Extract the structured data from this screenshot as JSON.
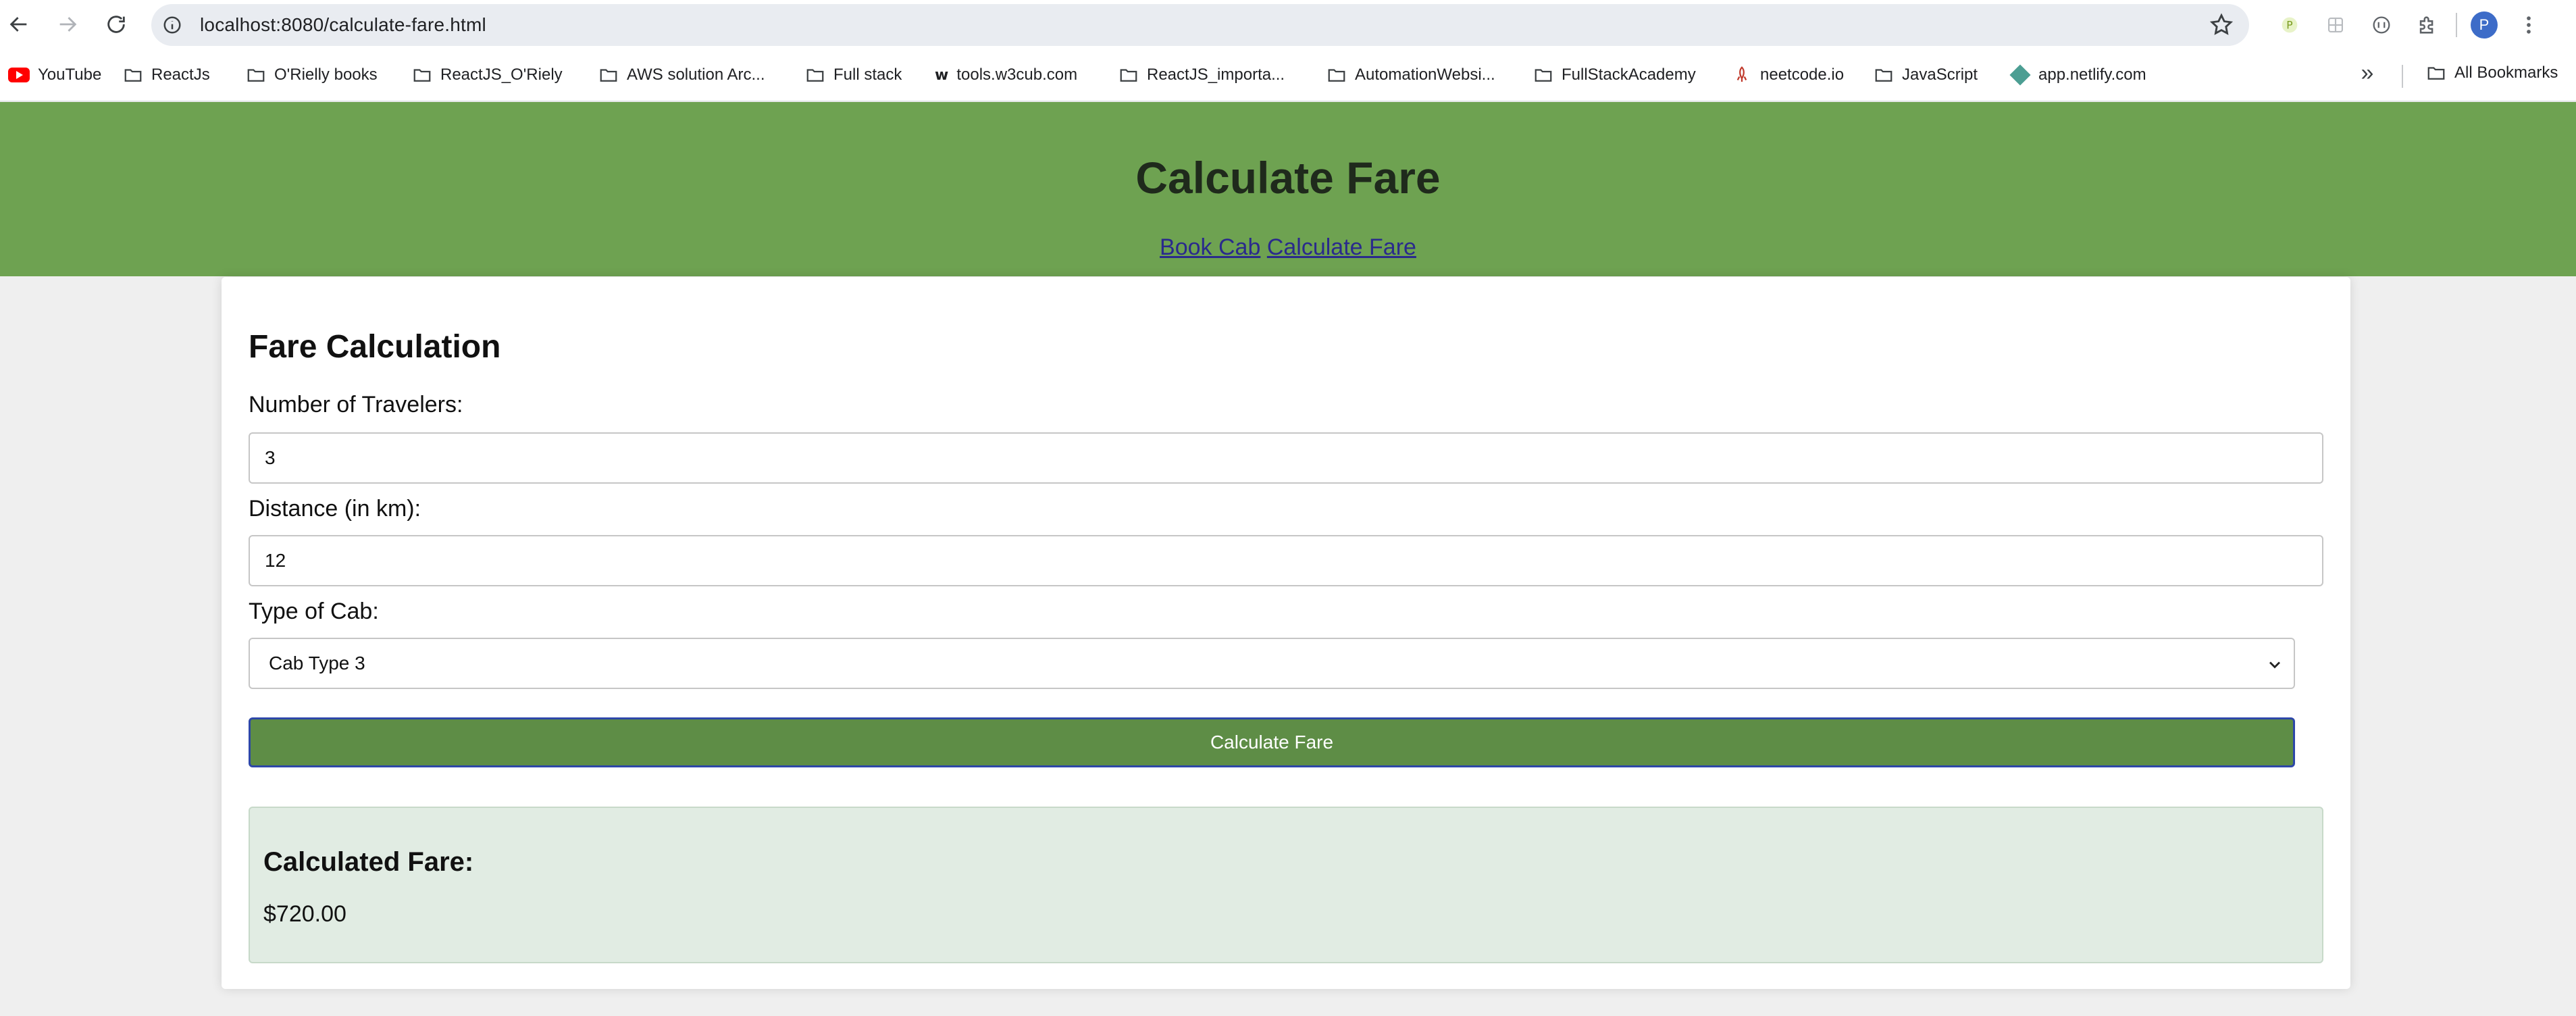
{
  "browser": {
    "url": "localhost:8080/calculate-fare.html",
    "profile_initial": "P",
    "bookmarks": [
      {
        "label": "YouTube",
        "icon": "youtube-icon"
      },
      {
        "label": "ReactJs",
        "icon": "folder-icon"
      },
      {
        "label": "O'Rielly books",
        "icon": "folder-icon"
      },
      {
        "label": "ReactJS_O'Riely",
        "icon": "folder-icon"
      },
      {
        "label": "AWS solution Arc...",
        "icon": "folder-icon"
      },
      {
        "label": "Full stack",
        "icon": "folder-icon"
      },
      {
        "label": "tools.w3cub.com",
        "icon": "w3cub-icon"
      },
      {
        "label": "ReactJS_importa...",
        "icon": "folder-icon"
      },
      {
        "label": "AutomationWebsi...",
        "icon": "folder-icon"
      },
      {
        "label": "FullStackAcademy",
        "icon": "folder-icon"
      },
      {
        "label": "neetcode.io",
        "icon": "rocket-icon"
      },
      {
        "label": "JavaScript",
        "icon": "folder-icon"
      },
      {
        "label": "app.netlify.com",
        "icon": "netlify-icon"
      }
    ],
    "more_bookmarks": "»",
    "all_bookmarks": "All Bookmarks"
  },
  "header": {
    "title": "Calculate Fare",
    "nav": {
      "book_cab": "Book Cab",
      "calculate_fare": "Calculate Fare"
    },
    "color": "#6ea251"
  },
  "form": {
    "heading": "Fare Calculation",
    "travelers_label": "Number of Travelers:",
    "travelers_value": "3",
    "distance_label": "Distance (in km):",
    "distance_value": "12",
    "cab_label": "Type of Cab:",
    "cab_selected": "Cab Type 3",
    "submit_label": "Calculate Fare",
    "button_color": "#5e8d46"
  },
  "result": {
    "heading": "Calculated Fare:",
    "amount": "$720.00"
  }
}
